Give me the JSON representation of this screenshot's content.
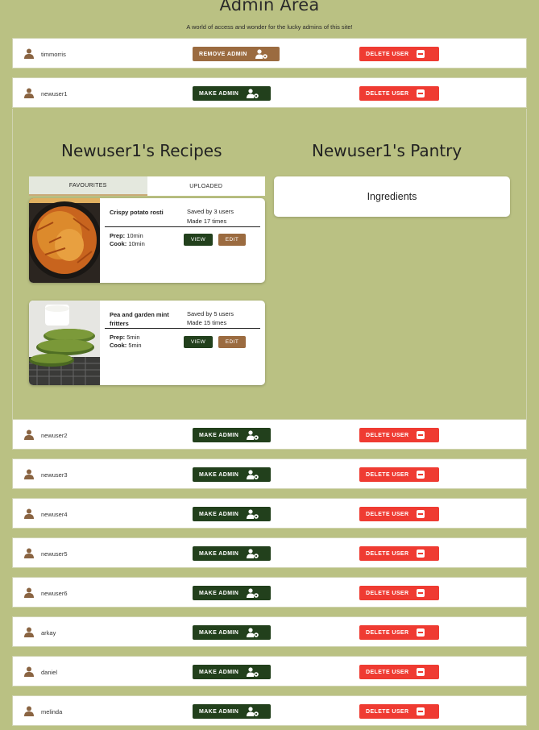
{
  "page": {
    "title": "Admin Area",
    "subtitle": "A world of access and wonder for the lucky admins of this site!"
  },
  "colors": {
    "background": "#bac183",
    "make_admin": "#22401c",
    "remove_admin": "#9b6b40",
    "delete": "#ef3b32"
  },
  "users": [
    {
      "name": "timmorris",
      "admin_label": "REMOVE ADMIN",
      "delete_label": "DELETE USER"
    },
    {
      "name": "newuser1",
      "admin_label": "MAKE ADMIN",
      "delete_label": "DELETE USER"
    },
    {
      "name": "newuser2",
      "admin_label": "MAKE ADMIN",
      "delete_label": "DELETE USER"
    },
    {
      "name": "newuser3",
      "admin_label": "MAKE ADMIN",
      "delete_label": "DELETE USER"
    },
    {
      "name": "newuser4",
      "admin_label": "MAKE ADMIN",
      "delete_label": "DELETE USER"
    },
    {
      "name": "newuser5",
      "admin_label": "MAKE ADMIN",
      "delete_label": "DELETE USER"
    },
    {
      "name": "newuser6",
      "admin_label": "MAKE ADMIN",
      "delete_label": "DELETE USER"
    },
    {
      "name": "arkay",
      "admin_label": "MAKE ADMIN",
      "delete_label": "DELETE USER"
    },
    {
      "name": "daniel",
      "admin_label": "MAKE ADMIN",
      "delete_label": "DELETE USER"
    },
    {
      "name": "melinda",
      "admin_label": "MAKE ADMIN",
      "delete_label": "DELETE USER"
    }
  ],
  "expanded": {
    "recipes_title": "Newuser1's Recipes",
    "pantry_title": "Newuser1's Pantry",
    "tabs": [
      "FAVOURITES",
      "UPLOADED"
    ],
    "active_tab": "FAVOURITES",
    "recipes": [
      {
        "name": "Crispy potato rosti",
        "saved": "Saved by 3 users",
        "made": "Made 17 times",
        "prep_label": "Prep:",
        "prep": "10min",
        "cook_label": "Cook:",
        "cook": "10min",
        "view_label": "VIEW",
        "edit_label": "EDIT",
        "image_icon": "potato-rosti-photo"
      },
      {
        "name": "Pea and garden mint fritters",
        "saved": "Saved by 5 users",
        "made": "Made 15 times",
        "prep_label": "Prep:",
        "prep": "5min",
        "cook_label": "Cook:",
        "cook": "5min",
        "view_label": "VIEW",
        "edit_label": "EDIT",
        "image_icon": "pea-fritters-photo"
      }
    ],
    "pantry_heading": "Ingredients"
  }
}
